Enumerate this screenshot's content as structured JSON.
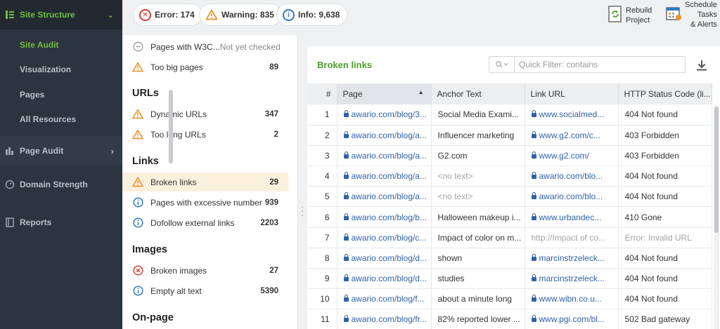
{
  "nav": {
    "section_main": {
      "label": "Site Structure",
      "icon": "site-structure-icon"
    },
    "sub_items": [
      {
        "label": "Site Audit",
        "active": true
      },
      {
        "label": "Visualization",
        "active": false
      },
      {
        "label": "Pages",
        "active": false
      },
      {
        "label": "All Resources",
        "active": false
      }
    ],
    "page_audit": {
      "label": "Page Audit",
      "icon": "page-audit-icon"
    },
    "domain_strength": {
      "label": "Domain Strength",
      "icon": "gauge-icon"
    },
    "reports": {
      "label": "Reports",
      "icon": "reports-icon"
    }
  },
  "topbar": {
    "error": {
      "label": "Error: 174",
      "icon": "error-icon",
      "color": "#d9403a"
    },
    "warning": {
      "label": "Warning: 835",
      "icon": "warning-icon",
      "color": "#e8932a"
    },
    "info": {
      "label": "Info: 9,638",
      "icon": "info-icon",
      "color": "#2f7cc4"
    },
    "rebuild": {
      "line1": "Rebuild",
      "line2": "Project",
      "icon": "rebuild-icon"
    },
    "schedule": {
      "line1": "Schedule",
      "line2": "Tasks",
      "line3": "& Alerts",
      "icon": "calendar-icon"
    }
  },
  "issues": {
    "top_rows": [
      {
        "label": "Pages with W3C...",
        "muted_suffix": "Not yet checked",
        "icon": "minus-circle-icon",
        "count": ""
      },
      {
        "label": "Too big pages",
        "icon": "warning-icon",
        "count": "89"
      }
    ],
    "urls_heading": "URLs",
    "urls_rows": [
      {
        "label": "Dynamic URLs",
        "icon": "warning-icon",
        "count": "347"
      },
      {
        "label": "Too long URLs",
        "icon": "warning-icon",
        "count": "2"
      }
    ],
    "links_heading": "Links",
    "links_rows": [
      {
        "label": "Broken links",
        "icon": "warning-icon",
        "count": "29",
        "selected": true
      },
      {
        "label": "Pages with excessive number ...",
        "icon": "info-icon",
        "count": "939"
      },
      {
        "label": "Dofollow external links",
        "icon": "info-icon",
        "count": "2203"
      }
    ],
    "images_heading": "Images",
    "images_rows": [
      {
        "label": "Broken images",
        "icon": "error-icon",
        "count": "27"
      },
      {
        "label": "Empty alt text",
        "icon": "info-icon",
        "count": "5390"
      }
    ],
    "onpage_heading": "On-page"
  },
  "panel": {
    "title": "Broken links",
    "filter_placeholder": "Quick Filter: contains",
    "columns": [
      "#",
      "Page",
      "Anchor Text",
      "Link URL",
      "HTTP Status Code (li..."
    ],
    "rows": [
      {
        "n": "1",
        "page": "awario.com/blog/3...",
        "anchor": "Social Media Exami...",
        "url": "www.socialmed...",
        "url_lock": true,
        "status": "404 Not found"
      },
      {
        "n": "2",
        "page": "awario.com/blog/a...",
        "anchor": "Influencer marketing",
        "url": "www.g2.com/c...",
        "url_lock": true,
        "status": "403 Forbidden"
      },
      {
        "n": "3",
        "page": "awario.com/blog/a...",
        "anchor": "G2.com",
        "url": "www.g2.com/",
        "url_lock": true,
        "status": "403 Forbidden"
      },
      {
        "n": "4",
        "page": "awario.com/blog/a...",
        "anchor": "<no text>",
        "anchor_muted": true,
        "url": "awario.com/blo...",
        "url_lock": true,
        "status": "404 Not found"
      },
      {
        "n": "5",
        "page": "awario.com/blog/a...",
        "anchor": "<no text>",
        "anchor_muted": true,
        "url": "awario.com/blo...",
        "url_lock": true,
        "status": "404 Not found"
      },
      {
        "n": "6",
        "page": "awario.com/blog/b...",
        "anchor": "Halloween makeup i...",
        "url": "www.urbandec...",
        "url_lock": true,
        "status": "410 Gone"
      },
      {
        "n": "7",
        "page": "awario.com/blog/c...",
        "anchor": "Impact of color on m...",
        "url": "http://Impact of co...",
        "url_lock": false,
        "url_muted": true,
        "status": "Error: Invalid URL",
        "status_muted": true
      },
      {
        "n": "8",
        "page": "awario.com/blog/d...",
        "anchor": "shown",
        "url": "marcinstrzeleck...",
        "url_lock": true,
        "status": "404 Not found"
      },
      {
        "n": "9",
        "page": "awario.com/blog/d...",
        "anchor": "studies",
        "url": "marcinstrzeleck...",
        "url_lock": true,
        "status": "404 Not found"
      },
      {
        "n": "10",
        "page": "awario.com/blog/f...",
        "anchor": "about a minute long",
        "url": "www.wibn.co.u...",
        "url_lock": true,
        "status": "404 Not found"
      },
      {
        "n": "11",
        "page": "awario.com/blog/fr...",
        "anchor": "82% reported lower ...",
        "url": "www.pgi.com/bl...",
        "url_lock": true,
        "status": "502 Bad gateway"
      }
    ]
  }
}
